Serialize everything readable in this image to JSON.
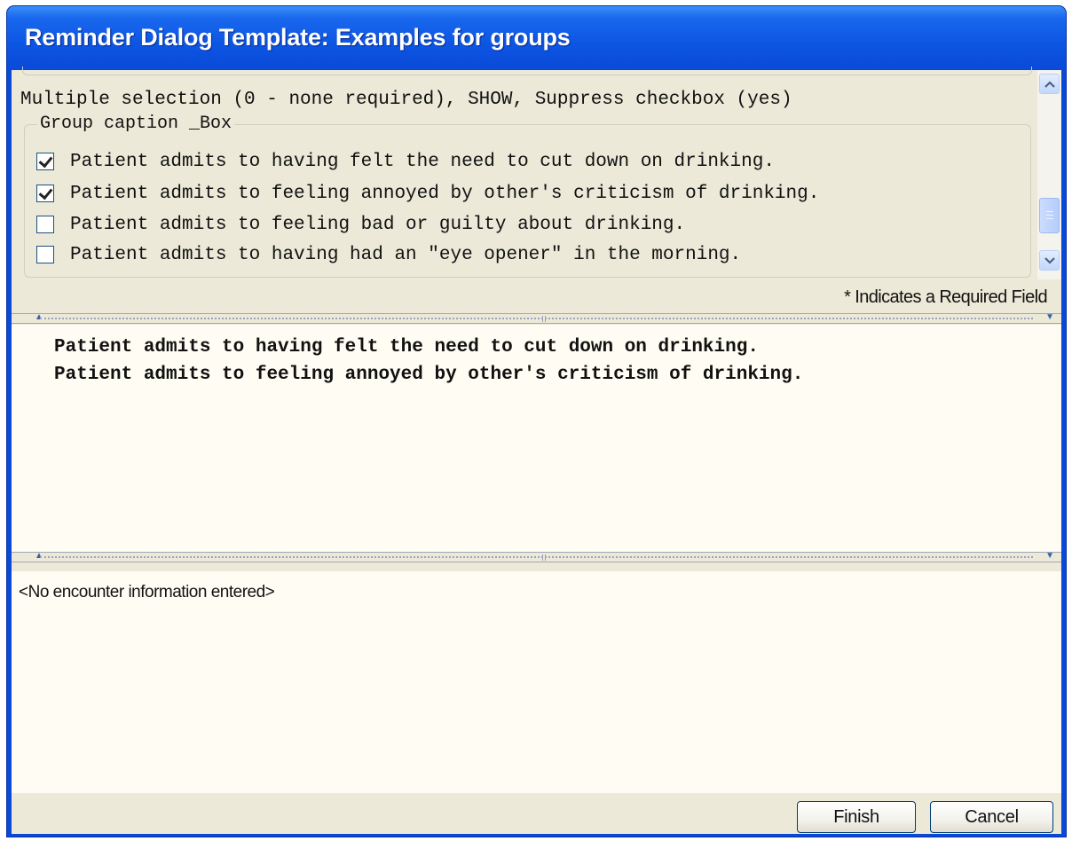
{
  "window": {
    "title": "Reminder Dialog Template: Examples for groups"
  },
  "options": {
    "section_caption": "Multiple selection (0 - none required), SHOW, Suppress checkbox (yes)",
    "group_caption": "Group caption _Box",
    "items": [
      {
        "label": "Patient admits to having felt the need to cut down on drinking.",
        "checked": true
      },
      {
        "label": "Patient admits to feeling annoyed by other's criticism of drinking.",
        "checked": true
      },
      {
        "label": "Patient admits to feeling bad or guilty about drinking.",
        "checked": false
      },
      {
        "label": "Patient admits to having had an \"eye opener\" in the morning.",
        "checked": false
      }
    ],
    "required_note": "* Indicates a Required Field"
  },
  "preview": {
    "lines": [
      "Patient admits to having felt the need to cut down on drinking.",
      "Patient admits to feeling annoyed by other's criticism of drinking."
    ]
  },
  "encounter": {
    "text": "<No encounter information entered>"
  },
  "buttons": {
    "finish": "Finish",
    "cancel": "Cancel"
  },
  "icons": {
    "scroll_up": "chevron-up-icon",
    "scroll_down": "chevron-down-icon",
    "checkmark": "checkmark-icon"
  }
}
